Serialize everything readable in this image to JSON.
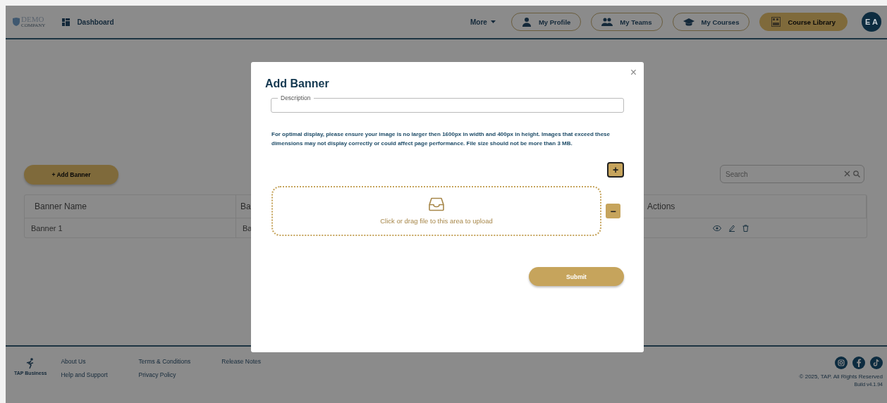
{
  "header": {
    "logo": {
      "name": "DEMO",
      "sub": "COMPANY"
    },
    "dashboard": "Dashboard",
    "more": "More",
    "nav": [
      {
        "label": "My Profile",
        "kind": "person",
        "selected": false
      },
      {
        "label": "My Teams",
        "kind": "people",
        "selected": false
      },
      {
        "label": "My Courses",
        "kind": "cap",
        "selected": false
      },
      {
        "label": "Course Library",
        "kind": "library",
        "selected": true
      }
    ],
    "avatar": "E A"
  },
  "toolbar": {
    "add_button": "+ Add Banner",
    "search": {
      "placeholder": "Search"
    }
  },
  "table": {
    "columns": [
      "Banner Name",
      "Ba",
      "Actions"
    ],
    "rows": [
      {
        "cells": [
          "Banner 1",
          "Ba"
        ]
      }
    ]
  },
  "footer": {
    "logo": "TAP Business",
    "links": [
      [
        "About Us",
        "Help and Support"
      ],
      [
        "Terms & Conditions",
        "Privacy Policy"
      ],
      [
        "Release Notes"
      ]
    ],
    "copyright": "© 2025, TAP. All Rights Reserved",
    "build": "Build v4.1.94"
  },
  "modal": {
    "title": "Add Banner",
    "close": "×",
    "description": {
      "label": "Description"
    },
    "info": "For optimal display, please ensure your image is no larger then 1600px in width and 400px in height. Images that exceed these dimensions may not display correctly or could affect page performance. File size should not be more than 3 MB.",
    "add": "+",
    "remove": "−",
    "upload": "Click or drag file to this area to upload",
    "submit": "Submit"
  }
}
